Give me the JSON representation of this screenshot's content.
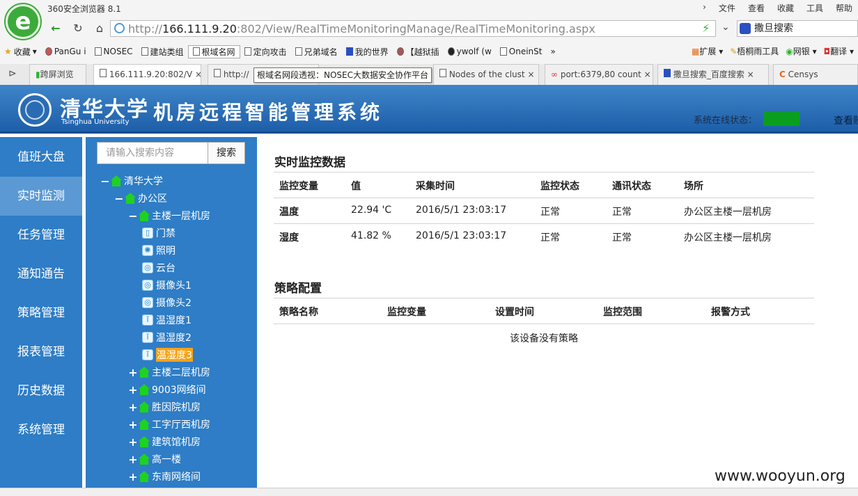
{
  "browser": {
    "window_title": "360安全浏览器 8.1",
    "menu": [
      "文件",
      "查看",
      "收藏",
      "工具",
      "帮助"
    ],
    "url_prefix": "http://",
    "url_host": "166.111.9.20",
    "url_rest": ":802/View/RealTimeMonitoringManage/RealTimeMonitoring.aspx",
    "search_engine_label": "撒旦搜索",
    "favorites": [
      "收藏",
      "PanGu i",
      "NOSEC",
      "建站类组",
      "根域名网",
      "定向攻击",
      "兄弟域名",
      "我的世界",
      "【越狱插",
      "ywolf (w",
      "OneinSt"
    ],
    "fav_right": [
      "扩展",
      "梧桐雨工具",
      "网银",
      "翻译"
    ],
    "tabs": [
      "跨屏浏览",
      "166.111.9.20:802/V",
      "http://",
      "Nodes of the clust",
      "port:6379,80 count",
      "撒旦搜索_百度搜索",
      "Censys"
    ],
    "tooltip": "根域名网段透视：NOSEC大数据安全协作平台",
    "more": "»"
  },
  "app": {
    "uni_name": "清华大学",
    "uni_en": "Tsinghua University",
    "system_title": "机房远程智能管理系统",
    "online_status_label": "系统在线状态：",
    "view_link": "查看账",
    "online_color": "#0a9e1e"
  },
  "sidebar": {
    "items": [
      "值班大盘",
      "实时监测",
      "任务管理",
      "通知通告",
      "策略管理",
      "报表管理",
      "历史数据",
      "系统管理"
    ],
    "active_index": 1
  },
  "tree": {
    "search_placeholder": "请输入搜索内容",
    "search_button": "搜索",
    "nodes": {
      "root": "清华大学",
      "office": "办公区",
      "room1": "主楼一层机房",
      "dev_door": "门禁",
      "dev_light": "照明",
      "dev_ptz": "云台",
      "dev_cam1": "摄像头1",
      "dev_cam2": "摄像头2",
      "dev_th1": "温湿度1",
      "dev_th2": "温湿度2",
      "dev_th3": "温湿度3",
      "room2": "主楼二层机房",
      "room3": "9003网络间",
      "room4": "胜因院机房",
      "room5": "工字厅西机房",
      "room6": "建筑馆机房",
      "room7": "高一楼",
      "room8": "东南网络间"
    },
    "toggle_minus": "−",
    "toggle_plus": "+"
  },
  "realtime": {
    "title": "实时监控数据",
    "headers": [
      "监控变量",
      "值",
      "采集时间",
      "监控状态",
      "通讯状态",
      "场所"
    ],
    "rows": [
      [
        "温度",
        "22.94 'C",
        "2016/5/1 23:03:17",
        "正常",
        "正常",
        "办公区主楼一层机房"
      ],
      [
        "湿度",
        "41.82 %",
        "2016/5/1 23:03:17",
        "正常",
        "正常",
        "办公区主楼一层机房"
      ]
    ]
  },
  "policy": {
    "title": "策略配置",
    "headers": [
      "策略名称",
      "监控变量",
      "设置时间",
      "监控范围",
      "报警方式"
    ],
    "empty_text": "该设备没有策略"
  },
  "watermark": "www.wooyun.org"
}
